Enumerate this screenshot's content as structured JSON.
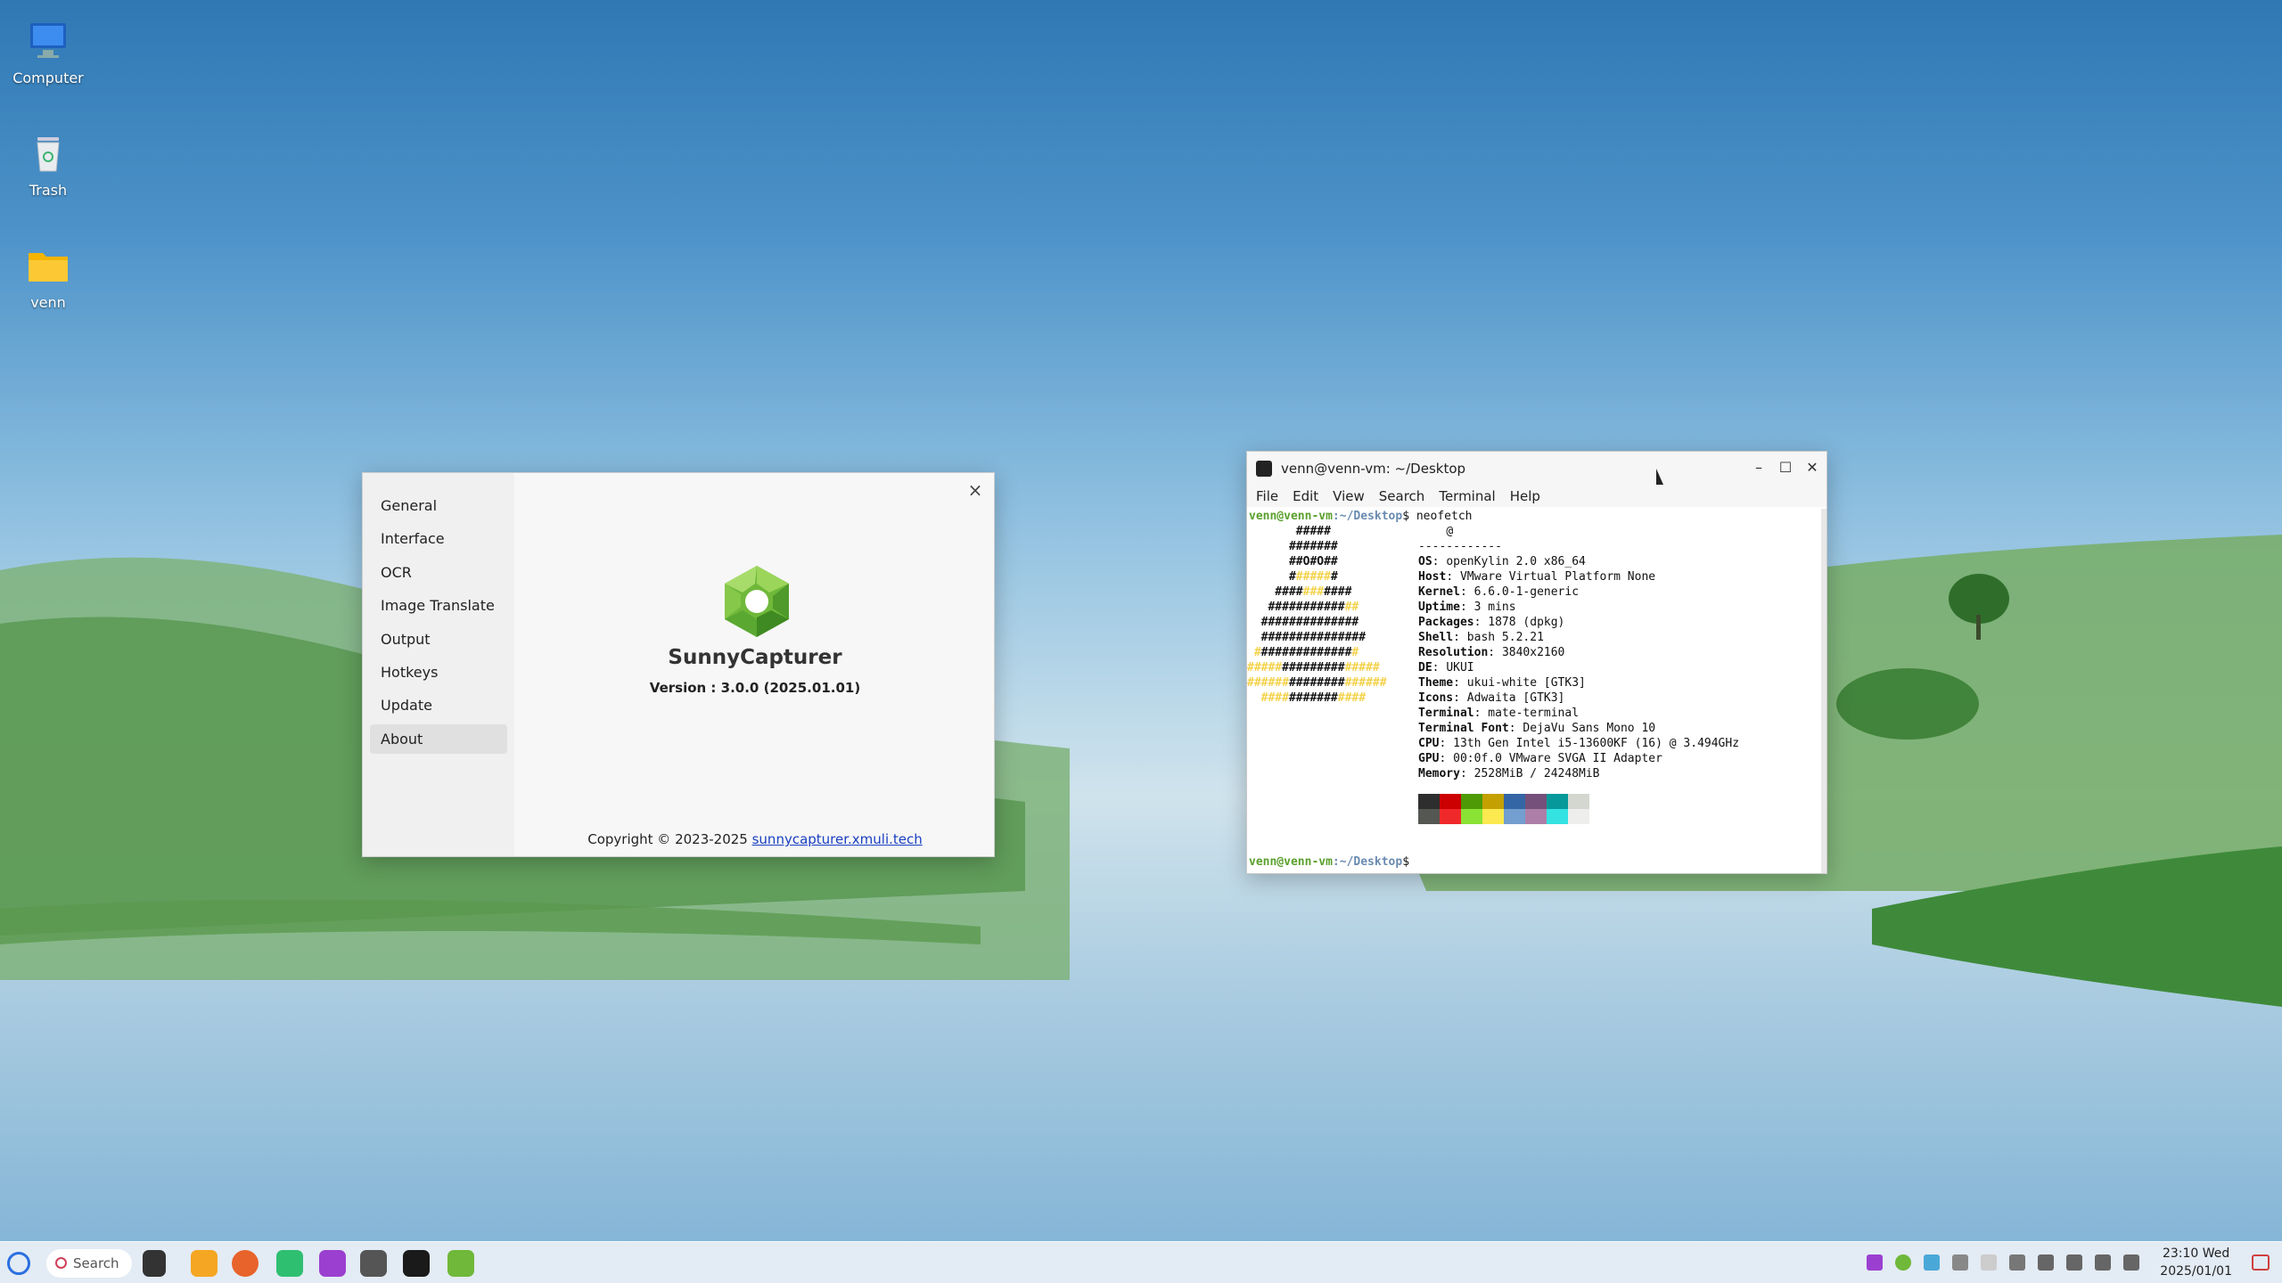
{
  "desktop": {
    "icons": [
      {
        "label": "Computer"
      },
      {
        "label": "Trash"
      },
      {
        "label": "venn"
      }
    ]
  },
  "sunnycapturer": {
    "nav": [
      "General",
      "Interface",
      "OCR",
      "Image Translate",
      "Output",
      "Hotkeys",
      "Update",
      "About"
    ],
    "active_nav": "About",
    "close": "×",
    "app_name": "SunnyCapturer",
    "version": "Version : 3.0.0 (2025.01.01)",
    "copyright": "Copyright © 2023-2025",
    "link": "sunnycapturer.xmuli.tech"
  },
  "terminal": {
    "title": "venn@venn-vm: ~/Desktop",
    "menu": [
      "File",
      "Edit",
      "View",
      "Search",
      "Terminal",
      "Help"
    ],
    "prompt_user": "venn@venn-vm",
    "prompt_path": ":~/Desktop",
    "prompt_symbol": "$",
    "command": "neofetch",
    "user_host_sep": "@",
    "separator": "------------",
    "info": [
      {
        "key": "OS",
        "value": "openKylin 2.0 x86_64"
      },
      {
        "key": "Host",
        "value": "VMware Virtual Platform None"
      },
      {
        "key": "Kernel",
        "value": "6.6.0-1-generic"
      },
      {
        "key": "Uptime",
        "value": "3 mins"
      },
      {
        "key": "Packages",
        "value": "1878 (dpkg)"
      },
      {
        "key": "Shell",
        "value": "bash 5.2.21"
      },
      {
        "key": "Resolution",
        "value": "3840x2160"
      },
      {
        "key": "DE",
        "value": "UKUI"
      },
      {
        "key": "Theme",
        "value": "ukui-white [GTK3]"
      },
      {
        "key": "Icons",
        "value": "Adwaita [GTK3]"
      },
      {
        "key": "Terminal",
        "value": "mate-terminal"
      },
      {
        "key": "Terminal Font",
        "value": "DejaVu Sans Mono 10"
      },
      {
        "key": "CPU",
        "value": "13th Gen Intel i5-13600KF (16) @ 3.494GHz"
      },
      {
        "key": "GPU",
        "value": "00:0f.0 VMware SVGA II Adapter"
      },
      {
        "key": "Memory",
        "value": "2528MiB / 24248MiB"
      }
    ],
    "swatch_colors_top": [
      "#2e2e2e",
      "#cc0000",
      "#4e9a06",
      "#c4a000",
      "#3465a4",
      "#75507b",
      "#06989a",
      "#d3d7cf"
    ],
    "swatch_colors_bottom": [
      "#555753",
      "#ef2929",
      "#8ae234",
      "#fce94f",
      "#729fcf",
      "#ad7fa8",
      "#34e2e2",
      "#eeeeec"
    ]
  },
  "taskbar": {
    "search_label": "Search",
    "time": "23:10 Wed",
    "date": "2025/01/01"
  }
}
